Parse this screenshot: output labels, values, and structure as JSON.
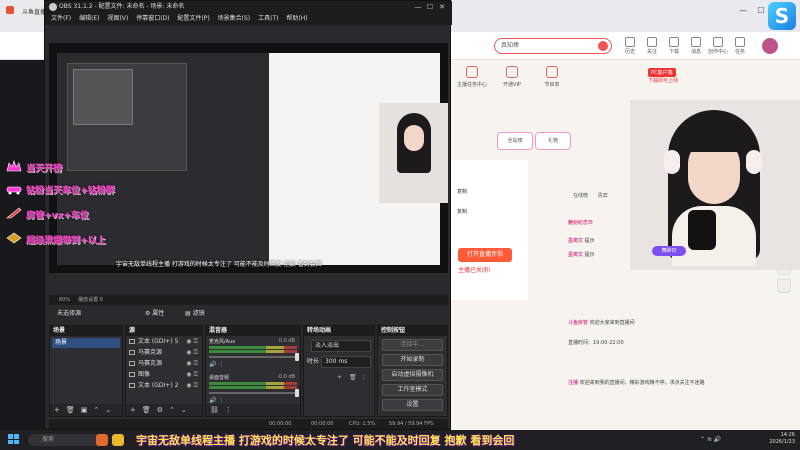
{
  "browser": {
    "tab_title": "斗鱼直播",
    "search_placeholder": "真知棒",
    "tools": [
      {
        "label": "历史"
      },
      {
        "label": "关注"
      },
      {
        "label": "下载"
      },
      {
        "label": "消息"
      },
      {
        "label": "创作中心"
      },
      {
        "label": "任务"
      }
    ],
    "window_controls": [
      "—",
      "☐",
      "✕"
    ]
  },
  "obs": {
    "title": "OBS 31.1.2 - 配置文件: 未命名 - 场景: 未命名",
    "menu": [
      "文件(F)",
      "编辑(E)",
      "视图(V)",
      "停靠窗口(D)",
      "配置文件(P)",
      "场景集合(S)",
      "工具(T)",
      "帮助(H)"
    ],
    "window_controls": [
      "—",
      "☐",
      "✕"
    ],
    "status_line": "60%",
    "status_right": "播放设置 0",
    "source_bar": {
      "label": "未选择源",
      "props": "属性",
      "filters": "滤镜"
    },
    "scenes": {
      "header": "场景",
      "items": [
        "场景"
      ]
    },
    "sources": {
      "header": "源",
      "items": [
        {
          "label": "文本 (GDI+) 5"
        },
        {
          "label": "马赛克源"
        },
        {
          "label": "马赛克源"
        },
        {
          "label": "图像"
        },
        {
          "label": "文本 (GDI+) 2"
        }
      ]
    },
    "mixer": {
      "header": "混音器",
      "channels": [
        {
          "name": "麦克风/Aux",
          "db": "0.0 dB"
        },
        {
          "name": "桌面音频",
          "db": "-0.0 dB"
        }
      ]
    },
    "transitions": {
      "header": "转场动画",
      "type": "淡入淡出",
      "duration_label": "时长",
      "duration_value": "300 ms"
    },
    "controls": {
      "header": "控制按钮",
      "buttons": [
        "连接中...",
        "开始录制",
        "启动虚拟摄像机",
        "工作室模式",
        "设置"
      ]
    },
    "footer": {
      "rec_time": "00:00:00",
      "stream_time": "00:00:00",
      "cpu": "CPU: 1.5%",
      "fps": "59.94 / 59.94 FPS"
    }
  },
  "page": {
    "pc_badge": "PC客户端",
    "pc_sub": "下载即可上线",
    "top_icons": [
      {
        "label": "主播任务中心"
      },
      {
        "label": "开通VIP"
      },
      {
        "label": "节目单"
      }
    ],
    "buttons": [
      {
        "label": "全站榜"
      },
      {
        "label": "礼物"
      }
    ],
    "popup": {
      "rows": [
        "复制",
        "复制"
      ],
      "action": "打开直播伴侣",
      "error": "主播已关闭!"
    },
    "tabs": [
      "在线榜",
      "贵宾"
    ],
    "chat": [
      {
        "name": "魅射纪念日",
        "text": ""
      },
      {
        "name": "墨离文",
        "text": "提示"
      },
      {
        "name": "墨离文",
        "text": "提示"
      },
      {
        "name": "斗鱼房管",
        "text": "欢迎大家来到直播间"
      },
      {
        "name": "",
        "text": "直播时间：19:00-22:00"
      },
      {
        "name": "注播",
        "text": "欢迎来到我的直播间，精彩游戏精不停，求点关注不迷路"
      }
    ],
    "webcam_tag": "舞醉日"
  },
  "overlay": {
    "stickers": [
      {
        "text": "当天开榜"
      },
      {
        "text": "钻粉当天车位+钻粉群"
      },
      {
        "text": "房管+vx+车位"
      },
      {
        "text": "超级黑爆带到+以上"
      }
    ],
    "subtitle_small": "宇宙无敌单线程主播 打游戏的时候太专注了 可能不能及时回复 抱歉 看到会回",
    "subtitle": "宇宙无敌单线程主播 打游戏的时候太专注了 可能不能及时回复 抱歉 看到会回"
  },
  "taskbar": {
    "search_placeholder": "搜索",
    "time": "14:26",
    "date": "2026/1/23"
  },
  "colors": {
    "accent_red": "#ff5a3a",
    "obs_panel": "#2d2d32",
    "scene_selected": "#2f4f80",
    "subtitle_yellow": "#ffe94a",
    "sticker_pink": "#ff3bd0"
  }
}
